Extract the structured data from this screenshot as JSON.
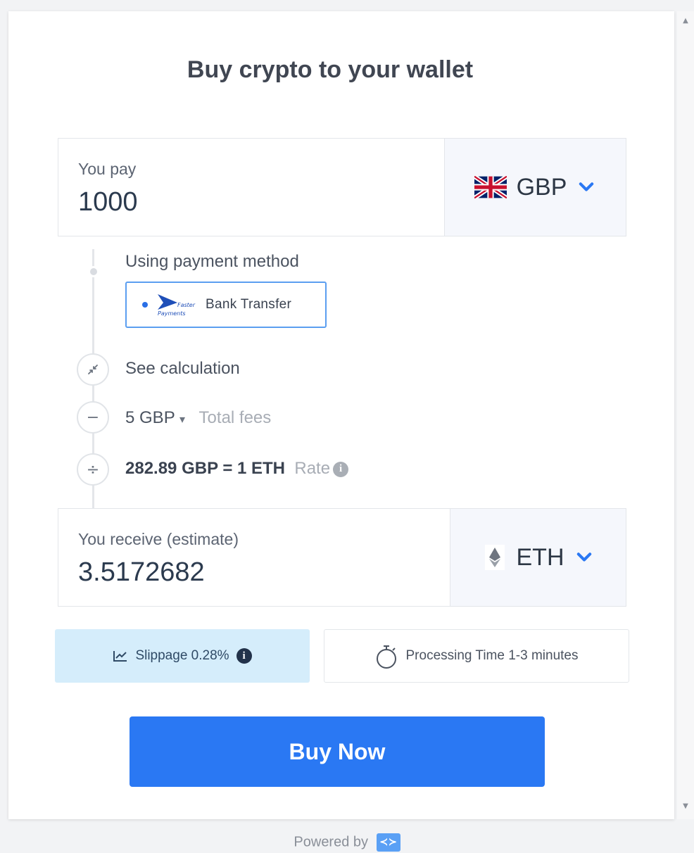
{
  "widget": {
    "title": "Buy crypto to your wallet"
  },
  "pay": {
    "label": "You pay",
    "amount": "1000",
    "currency": "GBP",
    "currency_flag_icon": "uk-flag-icon"
  },
  "payment_method": {
    "label": "Using payment method",
    "option_label": "Bank Transfer",
    "option_logo_text_1": "Faster",
    "option_logo_text_2": "Payments"
  },
  "calculation": {
    "see_calculation_label": "See calculation",
    "fees_amount": "5 GBP",
    "fees_caret": "▾",
    "fees_label": "Total fees",
    "rate_value": "282.89 GBP = 1 ETH",
    "rate_label": "Rate",
    "minus_symbol": "−",
    "divide_symbol": "÷"
  },
  "receive": {
    "label": "You receive (estimate)",
    "amount": "3.5172682",
    "currency": "ETH",
    "currency_icon": "ethereum-icon"
  },
  "chips": {
    "slippage_label": "Slippage 0.28%",
    "processing_label": "Processing Time 1-3 minutes"
  },
  "actions": {
    "buy_label": "Buy Now"
  },
  "footer": {
    "powered_by": "Powered by"
  },
  "colors": {
    "accent": "#2a78f3",
    "selected_border": "#5b9ef0",
    "slippage_bg": "#d5edfb"
  }
}
